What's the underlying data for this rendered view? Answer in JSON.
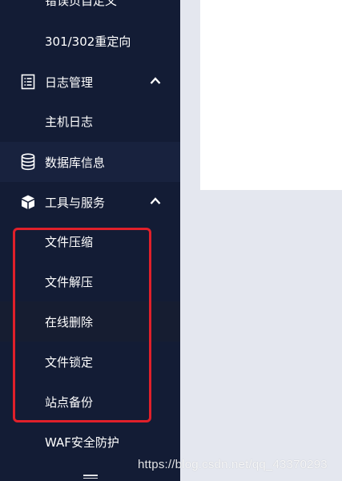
{
  "sidebar": {
    "partial_top_label": "错误页自定义",
    "items": [
      {
        "label": "301/302重定向",
        "type": "sub"
      },
      {
        "label": "日志管理",
        "type": "group",
        "icon": "log-list-icon",
        "expanded": true
      },
      {
        "label": "主机日志",
        "type": "sub"
      },
      {
        "label": "数据库信息",
        "type": "top",
        "icon": "database-icon"
      },
      {
        "label": "工具与服务",
        "type": "group",
        "icon": "cube-icon",
        "expanded": true
      },
      {
        "label": "文件压缩",
        "type": "sub"
      },
      {
        "label": "文件解压",
        "type": "sub"
      },
      {
        "label": "在线删除",
        "type": "sub"
      },
      {
        "label": "文件锁定",
        "type": "sub"
      },
      {
        "label": "站点备份",
        "type": "sub"
      },
      {
        "label": "WAF安全防护",
        "type": "sub"
      }
    ]
  },
  "watermark": "https://blog.csdn.net/qq_43370293",
  "colors": {
    "sidebar_bg": "#131c35",
    "highlight": "#18223e",
    "selection_frame": "#e0202a",
    "page_bg": "#e4e7ef"
  }
}
